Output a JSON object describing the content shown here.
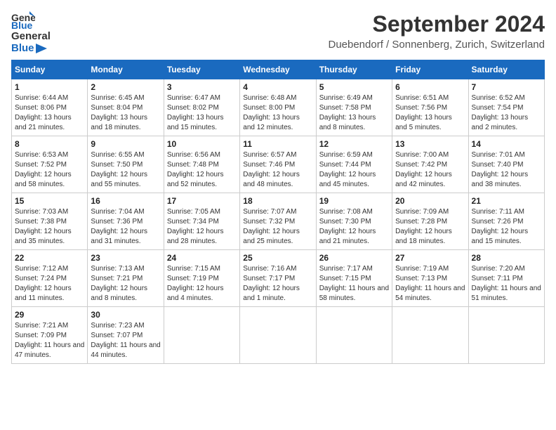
{
  "logo": {
    "general": "General",
    "blue": "Blue"
  },
  "title": "September 2024",
  "location": "Duebendorf / Sonnenberg, Zurich, Switzerland",
  "days": [
    "Sunday",
    "Monday",
    "Tuesday",
    "Wednesday",
    "Thursday",
    "Friday",
    "Saturday"
  ],
  "weeks": [
    [
      {
        "day": "1",
        "sunrise": "6:44 AM",
        "sunset": "8:06 PM",
        "daylight": "13 hours and 21 minutes."
      },
      {
        "day": "2",
        "sunrise": "6:45 AM",
        "sunset": "8:04 PM",
        "daylight": "13 hours and 18 minutes."
      },
      {
        "day": "3",
        "sunrise": "6:47 AM",
        "sunset": "8:02 PM",
        "daylight": "13 hours and 15 minutes."
      },
      {
        "day": "4",
        "sunrise": "6:48 AM",
        "sunset": "8:00 PM",
        "daylight": "13 hours and 12 minutes."
      },
      {
        "day": "5",
        "sunrise": "6:49 AM",
        "sunset": "7:58 PM",
        "daylight": "13 hours and 8 minutes."
      },
      {
        "day": "6",
        "sunrise": "6:51 AM",
        "sunset": "7:56 PM",
        "daylight": "13 hours and 5 minutes."
      },
      {
        "day": "7",
        "sunrise": "6:52 AM",
        "sunset": "7:54 PM",
        "daylight": "13 hours and 2 minutes."
      }
    ],
    [
      {
        "day": "8",
        "sunrise": "6:53 AM",
        "sunset": "7:52 PM",
        "daylight": "12 hours and 58 minutes."
      },
      {
        "day": "9",
        "sunrise": "6:55 AM",
        "sunset": "7:50 PM",
        "daylight": "12 hours and 55 minutes."
      },
      {
        "day": "10",
        "sunrise": "6:56 AM",
        "sunset": "7:48 PM",
        "daylight": "12 hours and 52 minutes."
      },
      {
        "day": "11",
        "sunrise": "6:57 AM",
        "sunset": "7:46 PM",
        "daylight": "12 hours and 48 minutes."
      },
      {
        "day": "12",
        "sunrise": "6:59 AM",
        "sunset": "7:44 PM",
        "daylight": "12 hours and 45 minutes."
      },
      {
        "day": "13",
        "sunrise": "7:00 AM",
        "sunset": "7:42 PM",
        "daylight": "12 hours and 42 minutes."
      },
      {
        "day": "14",
        "sunrise": "7:01 AM",
        "sunset": "7:40 PM",
        "daylight": "12 hours and 38 minutes."
      }
    ],
    [
      {
        "day": "15",
        "sunrise": "7:03 AM",
        "sunset": "7:38 PM",
        "daylight": "12 hours and 35 minutes."
      },
      {
        "day": "16",
        "sunrise": "7:04 AM",
        "sunset": "7:36 PM",
        "daylight": "12 hours and 31 minutes."
      },
      {
        "day": "17",
        "sunrise": "7:05 AM",
        "sunset": "7:34 PM",
        "daylight": "12 hours and 28 minutes."
      },
      {
        "day": "18",
        "sunrise": "7:07 AM",
        "sunset": "7:32 PM",
        "daylight": "12 hours and 25 minutes."
      },
      {
        "day": "19",
        "sunrise": "7:08 AM",
        "sunset": "7:30 PM",
        "daylight": "12 hours and 21 minutes."
      },
      {
        "day": "20",
        "sunrise": "7:09 AM",
        "sunset": "7:28 PM",
        "daylight": "12 hours and 18 minutes."
      },
      {
        "day": "21",
        "sunrise": "7:11 AM",
        "sunset": "7:26 PM",
        "daylight": "12 hours and 15 minutes."
      }
    ],
    [
      {
        "day": "22",
        "sunrise": "7:12 AM",
        "sunset": "7:24 PM",
        "daylight": "12 hours and 11 minutes."
      },
      {
        "day": "23",
        "sunrise": "7:13 AM",
        "sunset": "7:21 PM",
        "daylight": "12 hours and 8 minutes."
      },
      {
        "day": "24",
        "sunrise": "7:15 AM",
        "sunset": "7:19 PM",
        "daylight": "12 hours and 4 minutes."
      },
      {
        "day": "25",
        "sunrise": "7:16 AM",
        "sunset": "7:17 PM",
        "daylight": "12 hours and 1 minute."
      },
      {
        "day": "26",
        "sunrise": "7:17 AM",
        "sunset": "7:15 PM",
        "daylight": "11 hours and 58 minutes."
      },
      {
        "day": "27",
        "sunrise": "7:19 AM",
        "sunset": "7:13 PM",
        "daylight": "11 hours and 54 minutes."
      },
      {
        "day": "28",
        "sunrise": "7:20 AM",
        "sunset": "7:11 PM",
        "daylight": "11 hours and 51 minutes."
      }
    ],
    [
      {
        "day": "29",
        "sunrise": "7:21 AM",
        "sunset": "7:09 PM",
        "daylight": "11 hours and 47 minutes."
      },
      {
        "day": "30",
        "sunrise": "7:23 AM",
        "sunset": "7:07 PM",
        "daylight": "11 hours and 44 minutes."
      },
      null,
      null,
      null,
      null,
      null
    ]
  ],
  "labels": {
    "sunrise": "Sunrise:",
    "sunset": "Sunset:",
    "daylight": "Daylight:"
  }
}
